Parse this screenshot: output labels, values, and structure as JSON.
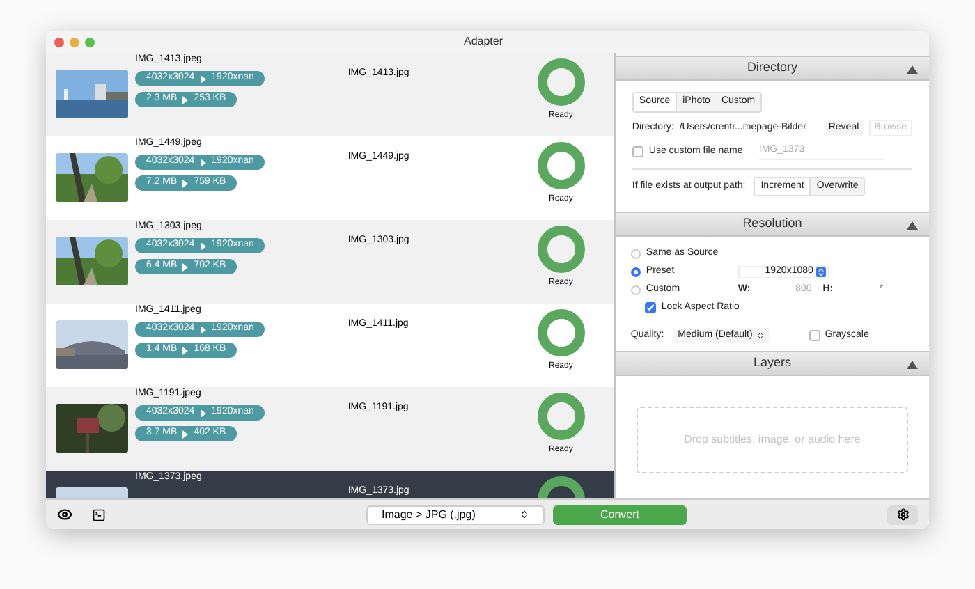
{
  "window": {
    "title": "Adapter"
  },
  "files": [
    {
      "name": "IMG_1413.jpeg",
      "output": "IMG_1413.jpg",
      "dims_from": "4032x3024",
      "dims_to": "1920xnan",
      "size_from": "2.3 MB",
      "size_to": "253 KB",
      "status": "Ready",
      "selected": false
    },
    {
      "name": "IMG_1449.jpeg",
      "output": "IMG_1449.jpg",
      "dims_from": "4032x3024",
      "dims_to": "1920xnan",
      "size_from": "7.2 MB",
      "size_to": "759 KB",
      "status": "Ready",
      "selected": false
    },
    {
      "name": "IMG_1303.jpeg",
      "output": "IMG_1303.jpg",
      "dims_from": "4032x3024",
      "dims_to": "1920xnan",
      "size_from": "6.4 MB",
      "size_to": "702 KB",
      "status": "Ready",
      "selected": false
    },
    {
      "name": "IMG_1411.jpeg",
      "output": "IMG_1411.jpg",
      "dims_from": "4032x3024",
      "dims_to": "1920xnan",
      "size_from": "1.4 MB",
      "size_to": "168 KB",
      "status": "Ready",
      "selected": false
    },
    {
      "name": "IMG_1191.jpeg",
      "output": "IMG_1191.jpg",
      "dims_from": "4032x3024",
      "dims_to": "1920xnan",
      "size_from": "3.7 MB",
      "size_to": "402 KB",
      "status": "Ready",
      "selected": false
    },
    {
      "name": "IMG_1373.jpeg",
      "output": "IMG_1373.jpg",
      "selected": true
    }
  ],
  "directory": {
    "title": "Directory",
    "sources": [
      {
        "label": "Source",
        "selected": true
      },
      {
        "label": "iPhoto",
        "selected": false
      },
      {
        "label": "Custom",
        "selected": false
      }
    ],
    "label": "Directory:",
    "path": "/Users/crentr...mepage-Bilder",
    "reveal": "Reveal",
    "browse": "Browse",
    "browse_disabled": true,
    "custom_name": {
      "label": "Use custom file name",
      "checked": false,
      "placeholder": "IMG_1373"
    },
    "exists_label": "If file exists at output path:",
    "exists_options": [
      {
        "label": "Increment",
        "selected": true
      },
      {
        "label": "Overwrite",
        "selected": false
      }
    ]
  },
  "resolution": {
    "title": "Resolution",
    "options": [
      {
        "label": "Same as Source",
        "selected": false
      },
      {
        "label": "Preset",
        "selected": true
      },
      {
        "label": "Custom",
        "selected": false
      }
    ],
    "preset": "1920x1080",
    "w_label": "W:",
    "w_placeholder": "800",
    "h_label": "H:",
    "h_placeholder": "*",
    "lock": {
      "label": "Lock Aspect Ratio",
      "checked": true
    },
    "quality_label": "Quality:",
    "quality": "Medium (Default)",
    "grayscale": {
      "label": "Grayscale",
      "checked": false
    }
  },
  "layers": {
    "title": "Layers",
    "drop_hint": "Drop subtitles, image, or audio here"
  },
  "bottom": {
    "format": "Image > JPG (.jpg)",
    "convert": "Convert"
  }
}
